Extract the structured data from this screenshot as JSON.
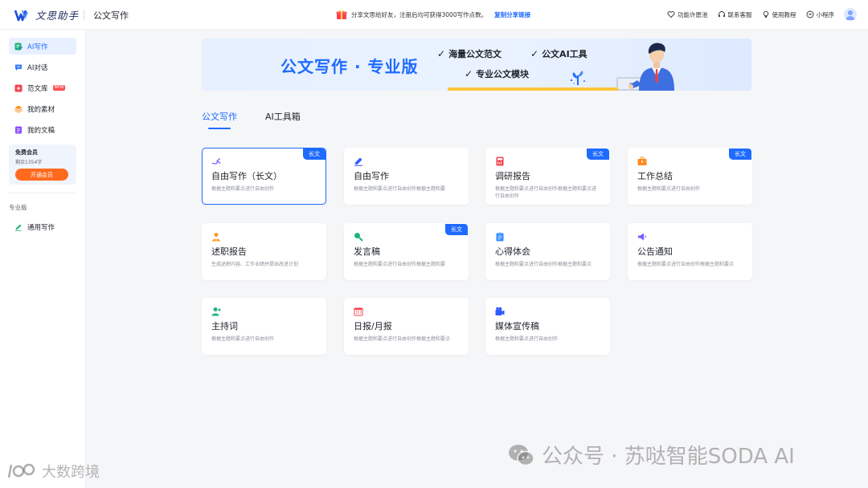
{
  "header": {
    "logo_text": "文思助手",
    "page_title": "公文写作",
    "promo_text": "分享文思给好友，注册后均可获得3000写作点数。",
    "promo_link": "复制分享链接",
    "right_items": [
      {
        "label": "功能许愿池",
        "icon": "heart-icon"
      },
      {
        "label": "联系客服",
        "icon": "headset-icon"
      },
      {
        "label": "使用教程",
        "icon": "bulb-icon"
      },
      {
        "label": "小程序",
        "icon": "mini-program-icon"
      }
    ]
  },
  "sidebar": {
    "items": [
      {
        "label": "AI写作",
        "icon": "ai-write-icon",
        "color": "#1fb57a",
        "active": true
      },
      {
        "label": "AI对话",
        "icon": "chat-icon",
        "color": "#3a7bff"
      },
      {
        "label": "范文库",
        "icon": "library-icon",
        "color": "#f5424e",
        "badge": "NEW"
      },
      {
        "label": "我的素材",
        "icon": "materials-icon",
        "color": "#ff8a1f"
      },
      {
        "label": "我的文稿",
        "icon": "documents-icon",
        "color": "#8a4dff"
      }
    ],
    "member": {
      "title": "免费会员",
      "remain": "剩余1354字",
      "button": "开通会员"
    },
    "section_label": "专业版",
    "pro_items": [
      {
        "label": "通用写作",
        "icon": "pen-icon",
        "color": "#1fb57a"
      }
    ]
  },
  "banner": {
    "title": "公文写作 · 专业版",
    "features": [
      "海量公文范文",
      "公文AI工具",
      "专业公文模块"
    ]
  },
  "tabs": [
    {
      "label": "公文写作",
      "active": true
    },
    {
      "label": "AI工具箱",
      "active": false
    }
  ],
  "cards": [
    {
      "title": "自由写作（长文）",
      "desc": "根据主题和要点进行自由创作",
      "tag": "长文",
      "icon": "pen-scribble-icon",
      "color": "#7b5cff",
      "selected": true
    },
    {
      "title": "自由写作",
      "desc": "根据主题和要点进行自由创作根据主题和要",
      "tag": "",
      "icon": "pencil-icon",
      "color": "#2f5bff"
    },
    {
      "title": "调研报告",
      "desc": "根据主题和要点进行自由创作根据主题和要点进行自由创作",
      "tag": "长文",
      "icon": "report-book-icon",
      "color": "#f5424e"
    },
    {
      "title": "工作总结",
      "desc": "根据主题和要点进行自由创作",
      "tag": "长文",
      "icon": "briefcase-icon",
      "color": "#ff8a1f"
    },
    {
      "title": "述职报告",
      "desc": "生成述职内容、工作业绩并提出改进计划",
      "tag": "",
      "icon": "person-icon",
      "color": "#ff9a1f"
    },
    {
      "title": "发言稿",
      "desc": "根据主题和要点进行自由创作根据主题和要",
      "tag": "长文",
      "icon": "speech-icon",
      "color": "#1fb57a"
    },
    {
      "title": "心得体会",
      "desc": "根据主题和要点进行自由创作根据主题和要点",
      "tag": "",
      "icon": "clipboard-icon",
      "color": "#2f8bff"
    },
    {
      "title": "公告通知",
      "desc": "根据主题和要点进行自由创作根据主题和要点",
      "tag": "",
      "icon": "megaphone-icon",
      "color": "#7b5cff"
    },
    {
      "title": "主持词",
      "desc": "根据主题和要点进行自由创作",
      "tag": "",
      "icon": "host-icon",
      "color": "#1fb57a"
    },
    {
      "title": "日报/月报",
      "desc": "根据主题和要点进行自由创作根据主题和要点",
      "tag": "",
      "icon": "calendar-icon",
      "color": "#f5424e"
    },
    {
      "title": "媒体宣传稿",
      "desc": "根据主题和要点进行自由创作",
      "tag": "",
      "icon": "camera-icon",
      "color": "#2f5bff"
    }
  ],
  "watermark": {
    "right": "公众号 · 苏哒智能SODA AI",
    "left": "大数跨境"
  },
  "colors": {
    "accent": "#1f6bff",
    "member_button": "#ff6a1f",
    "banner_bar": "#ffc53d"
  }
}
